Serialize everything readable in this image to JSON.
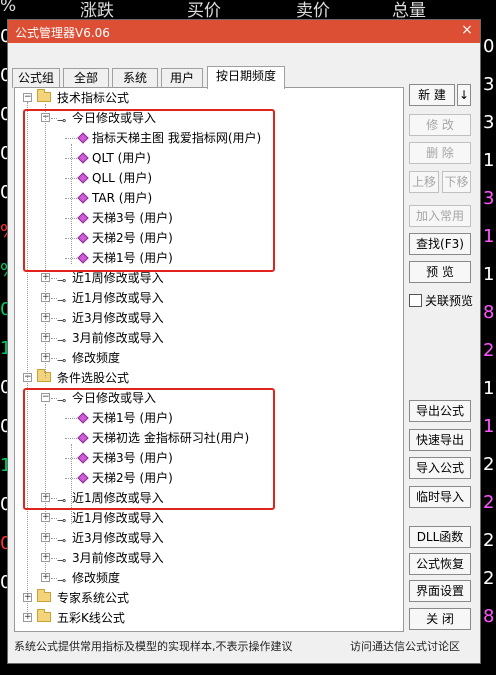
{
  "bg_header": [
    "%",
    "涨跌",
    "买价",
    "卖价",
    "总量"
  ],
  "bg_left_rows": [
    {
      "text": "0",
      "color": "#ffffff"
    },
    {
      "text": "0",
      "color": "#ffffff"
    },
    {
      "text": "0",
      "color": "#ffffff"
    },
    {
      "text": "0",
      "color": "#ffffff"
    },
    {
      "text": "0",
      "color": "#ffffff"
    },
    {
      "text": "%",
      "color": "#ff3333"
    },
    {
      "text": "%",
      "color": "#00cc66"
    },
    {
      "text": "0",
      "color": "#00cc66"
    },
    {
      "text": "1",
      "color": "#00cc66"
    },
    {
      "text": "0",
      "color": "#ffffff"
    },
    {
      "text": "0",
      "color": "#ffffff"
    },
    {
      "text": "1",
      "color": "#00cc66"
    },
    {
      "text": "0",
      "color": "#ffffff"
    },
    {
      "text": "0",
      "color": "#ff3333"
    },
    {
      "text": "0",
      "color": "#ffffff"
    }
  ],
  "bg_right_rows": [
    {
      "text": "0",
      "color": "#ffffff"
    },
    {
      "text": "3",
      "color": "#ffffff"
    },
    {
      "text": "3",
      "color": "#ffffff"
    },
    {
      "text": "1",
      "color": "#ffffff"
    },
    {
      "text": "3",
      "color": "#ff55ff"
    },
    {
      "text": "1",
      "color": "#ff55ff"
    },
    {
      "text": "1",
      "color": "#ffffff"
    },
    {
      "text": "8",
      "color": "#ff55ff"
    },
    {
      "text": "2",
      "color": "#ff55ff"
    },
    {
      "text": "1",
      "color": "#ffffff"
    },
    {
      "text": "1",
      "color": "#ff55ff"
    },
    {
      "text": "2",
      "color": "#ffffff"
    },
    {
      "text": "2",
      "color": "#ff55ff"
    },
    {
      "text": "2",
      "color": "#ffffff"
    },
    {
      "text": "2",
      "color": "#ffffff"
    },
    {
      "text": "8",
      "color": "#ff55ff"
    }
  ],
  "window": {
    "title": "公式管理器V6.06",
    "close": "×"
  },
  "tabs": [
    "公式组",
    "全部",
    "系统",
    "用户",
    "按日期频度"
  ],
  "tree": [
    {
      "label": "技术指标公式",
      "type": "folder",
      "level": 0,
      "expander": "-"
    },
    {
      "label": "今日修改或导入",
      "type": "key",
      "level": 1,
      "expander": "-"
    },
    {
      "label": "指标天梯主图  我爱指标网(用户)",
      "type": "item",
      "level": 2
    },
    {
      "label": "QLT  (用户)",
      "type": "item",
      "level": 2
    },
    {
      "label": "QLL  (用户)",
      "type": "item",
      "level": 2
    },
    {
      "label": "TAR  (用户)",
      "type": "item",
      "level": 2
    },
    {
      "label": "天梯3号  (用户)",
      "type": "item",
      "level": 2
    },
    {
      "label": "天梯2号  (用户)",
      "type": "item",
      "level": 2
    },
    {
      "label": "天梯1号  (用户)",
      "type": "item",
      "level": 2
    },
    {
      "label": "近1周修改或导入",
      "type": "key",
      "level": 1,
      "expander": "+"
    },
    {
      "label": "近1月修改或导入",
      "type": "key",
      "level": 1,
      "expander": "+"
    },
    {
      "label": "近3月修改或导入",
      "type": "key",
      "level": 1,
      "expander": "+"
    },
    {
      "label": "3月前修改或导入",
      "type": "key",
      "level": 1,
      "expander": "+"
    },
    {
      "label": "修改频度",
      "type": "key",
      "level": 1,
      "expander": "+"
    },
    {
      "label": "条件选股公式",
      "type": "folder",
      "level": 0,
      "expander": "-"
    },
    {
      "label": "今日修改或导入",
      "type": "key",
      "level": 1,
      "expander": "-"
    },
    {
      "label": "天梯1号  (用户)",
      "type": "item",
      "level": 2
    },
    {
      "label": "天梯初选  金指标研习社(用户)",
      "type": "item",
      "level": 2
    },
    {
      "label": "天梯3号  (用户)",
      "type": "item",
      "level": 2
    },
    {
      "label": "天梯2号  (用户)",
      "type": "item",
      "level": 2
    },
    {
      "label": "近1周修改或导入",
      "type": "key",
      "level": 1,
      "expander": "+"
    },
    {
      "label": "近1月修改或导入",
      "type": "key",
      "level": 1,
      "expander": "+"
    },
    {
      "label": "近3月修改或导入",
      "type": "key",
      "level": 1,
      "expander": "+"
    },
    {
      "label": "3月前修改或导入",
      "type": "key",
      "level": 1,
      "expander": "+"
    },
    {
      "label": "修改频度",
      "type": "key",
      "level": 1,
      "expander": "+"
    },
    {
      "label": "专家系统公式",
      "type": "folder",
      "level": 0,
      "expander": "+"
    },
    {
      "label": "五彩K线公式",
      "type": "folder",
      "level": 0,
      "expander": "+"
    }
  ],
  "buttons": {
    "new": "新  建",
    "new_arrow": "↓",
    "edit": "修  改",
    "delete": "删  除",
    "move_up": "上移",
    "move_down": "下移",
    "add_common": "加入常用",
    "find": "查找(F3)",
    "preview": "预  览",
    "link_preview": "关联预览",
    "export": "导出公式",
    "quick_export": "快速导出",
    "import": "导入公式",
    "temp_import": "临时导入",
    "dll": "DLL函数",
    "restore": "公式恢复",
    "ui_settings": "界面设置",
    "close": "关  闭"
  },
  "status": {
    "left": "系统公式提供常用指标及模型的实现样本,不表示操作建议",
    "right": "访问通达信公式讨论区"
  }
}
